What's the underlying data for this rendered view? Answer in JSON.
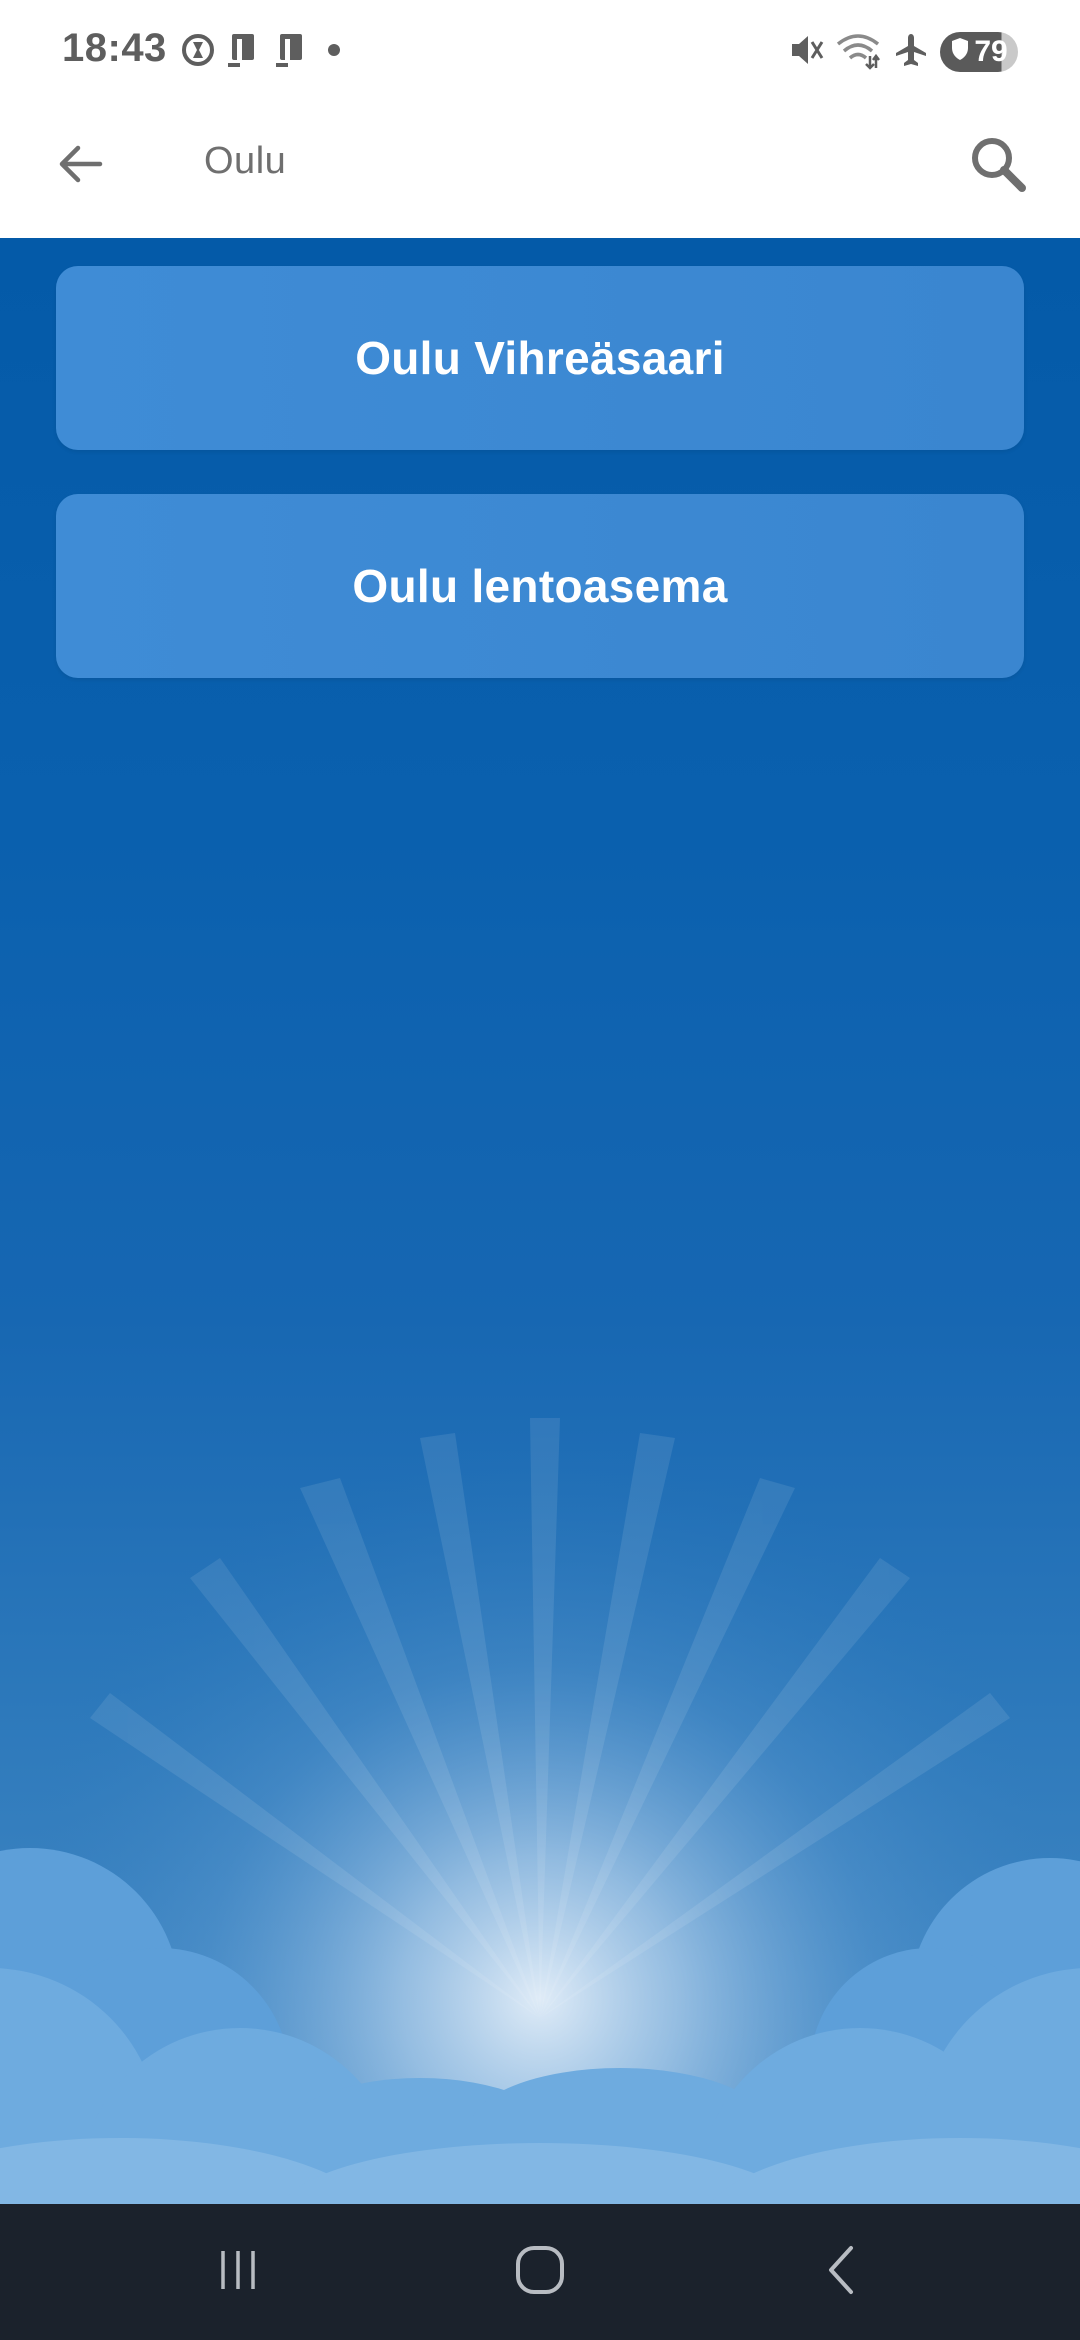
{
  "status_bar": {
    "time": "18:43",
    "battery_level": "79",
    "left_icons": [
      "timer-icon",
      "sim-card-icon",
      "sim-card-icon",
      "notification-dot-icon"
    ],
    "right_icons": [
      "mute-icon",
      "wifi-icon",
      "airplane-mode-icon",
      "battery-shield-icon"
    ]
  },
  "app_bar": {
    "search_query": "Oulu",
    "back_icon": "arrow-left-icon",
    "search_icon": "search-icon"
  },
  "results": [
    {
      "label": "Oulu Vihreäsaari"
    },
    {
      "label": "Oulu lentoasema"
    }
  ],
  "nav_bar": {
    "icons": [
      "recent-apps-icon",
      "home-icon",
      "back-chevron-icon"
    ]
  },
  "colors": {
    "background_top": "#045aa8",
    "card": "#3f8cd6",
    "nav_bar": "#1b222c",
    "icon_gray": "#6f6f6f"
  }
}
